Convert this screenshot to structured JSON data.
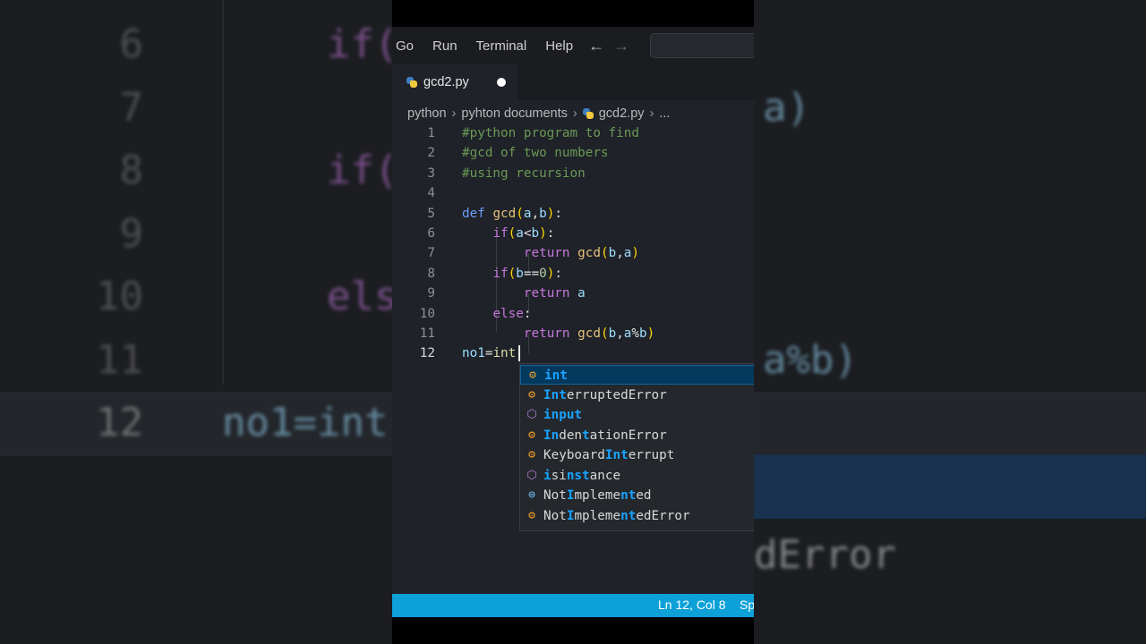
{
  "menu": {
    "items": [
      {
        "label": "Go"
      },
      {
        "label": "Run"
      },
      {
        "label": "Terminal"
      },
      {
        "label": "Help"
      }
    ],
    "back_icon": "arrow-left-icon",
    "forward_icon": "arrow-right-icon"
  },
  "tab": {
    "filename": "gcd2.py",
    "icon": "python-file-icon",
    "modified": true
  },
  "breadcrumb": {
    "items": [
      "python",
      "pyhton documents",
      "gcd2.py",
      "..."
    ],
    "separator": "›"
  },
  "code": {
    "line_numbers": [
      "1",
      "2",
      "3",
      "4",
      "5",
      "6",
      "7",
      "8",
      "9",
      "10",
      "11",
      "12"
    ],
    "active_line": "12",
    "lines": [
      "#python program to find",
      "#gcd of two numbers",
      "#using recursion",
      "",
      "def gcd(a,b):",
      "    if(a<b):",
      "        return gcd(b,a)",
      "    if(b==0):",
      "        return a",
      "    else:",
      "        return gcd(b,a%b)",
      "no1=int"
    ]
  },
  "suggestions": {
    "items": [
      {
        "label": "int",
        "kind": "class",
        "selected": true
      },
      {
        "label": "InterruptedError",
        "kind": "class"
      },
      {
        "label": "input",
        "kind": "function"
      },
      {
        "label": "IndentationError",
        "kind": "class"
      },
      {
        "label": "KeyboardInterrupt",
        "kind": "class"
      },
      {
        "label": "isinstance",
        "kind": "function"
      },
      {
        "label": "NotImplemented",
        "kind": "constant"
      },
      {
        "label": "NotImplementedError",
        "kind": "class"
      }
    ]
  },
  "status": {
    "position": "Ln 12, Col 8",
    "spaces": "Sp"
  },
  "background_zoom": {
    "numbers": [
      "6",
      "7",
      "8",
      "9",
      "10",
      "11",
      "12"
    ],
    "fragments": {
      "if1": "if(",
      "if2": "if(",
      "else": "els",
      "no1": "no1=int",
      "a_paren": "a)",
      "amodb": "a%b)",
      "derror": "dError"
    }
  },
  "colors": {
    "status_bar": "#0da1d8",
    "suggest_selected": "#04395e",
    "editor_bg": "#1f2228"
  }
}
